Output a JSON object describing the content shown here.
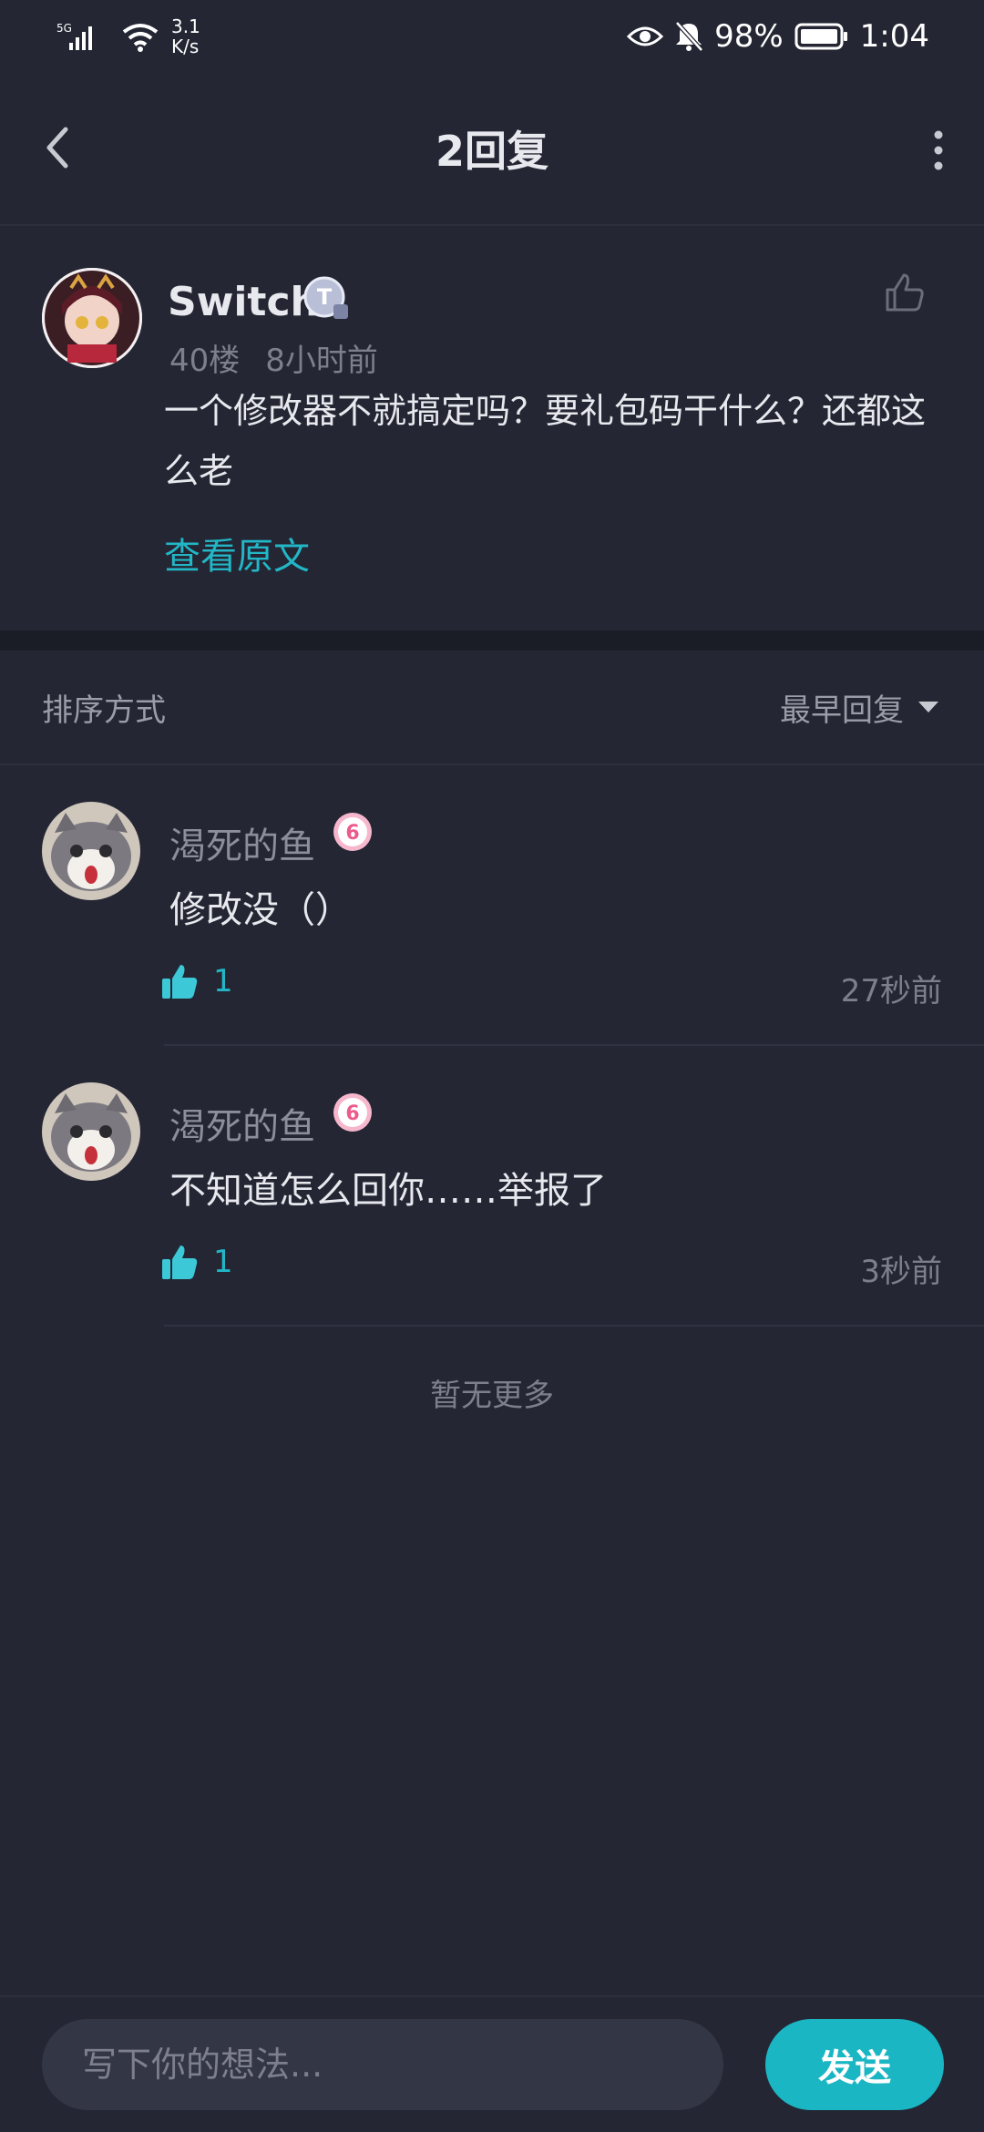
{
  "status_bar": {
    "network": "5G",
    "speed_value": "3.1",
    "speed_unit": "K/s",
    "battery": "98%",
    "time": "1:04"
  },
  "header": {
    "title": "2回复",
    "back_icon": "chevron-left-icon",
    "more_icon": "more-vertical-icon"
  },
  "original_comment": {
    "author": "Switch",
    "badge_letter": "T",
    "floor": "40楼",
    "time": "8小时前",
    "text": "一个修改器不就搞定吗？要礼包码干什么？还都这么老",
    "view_original": "查看原文"
  },
  "sort": {
    "label": "排序方式",
    "selected": "最早回复"
  },
  "replies": [
    {
      "author": "渴死的鱼",
      "level": "6",
      "text": "修改没（）",
      "likes": "1",
      "time": "27秒前"
    },
    {
      "author": "渴死的鱼",
      "level": "6",
      "text": "不知道怎么回你……举报了",
      "likes": "1",
      "time": "3秒前"
    }
  ],
  "no_more": "暂无更多",
  "composer": {
    "placeholder": "写下你的想法...",
    "send_label": "发送"
  },
  "colors": {
    "background": "#242633",
    "accent": "#1bb6c4",
    "text_primary": "#e8e9ee",
    "text_secondary": "#7d808c"
  }
}
